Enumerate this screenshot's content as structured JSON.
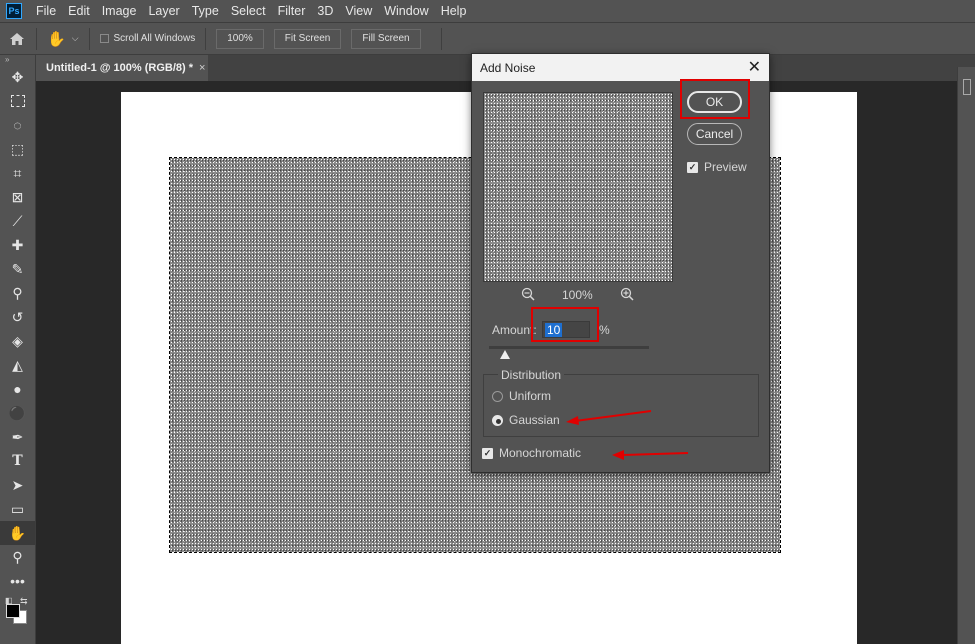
{
  "app": {
    "logo_text": "Ps"
  },
  "menu": [
    "File",
    "Edit",
    "Image",
    "Layer",
    "Type",
    "Select",
    "Filter",
    "3D",
    "View",
    "Window",
    "Help"
  ],
  "options_bar": {
    "scroll_all_windows_label": "Scroll All Windows",
    "zoom_100_label": "100%",
    "fit_screen_label": "Fit Screen",
    "fill_screen_label": "Fill Screen"
  },
  "document_tab": {
    "title": "Untitled-1 @ 100% (RGB/8) *",
    "close": "×"
  },
  "dialog": {
    "title": "Add Noise",
    "close": "✕",
    "ok_label": "OK",
    "cancel_label": "Cancel",
    "preview_label": "Preview",
    "preview_checked": true,
    "zoom_level": "100%",
    "amount_label": "Amount:",
    "amount_value": "10",
    "amount_unit": "%",
    "amount_slider_fraction": 0.1,
    "distribution_label": "Distribution",
    "uniform_label": "Uniform",
    "gaussian_label": "Gaussian",
    "selected_distribution": "Gaussian",
    "monochromatic_label": "Monochromatic",
    "monochromatic_checked": true
  },
  "colors": {
    "annotation_red": "#e00000",
    "ui_gray": "#535353"
  },
  "icons": [
    "home-icon",
    "hand-icon",
    "chevron-down-icon",
    "zoom-out-icon",
    "zoom-in-icon",
    "close-icon"
  ]
}
